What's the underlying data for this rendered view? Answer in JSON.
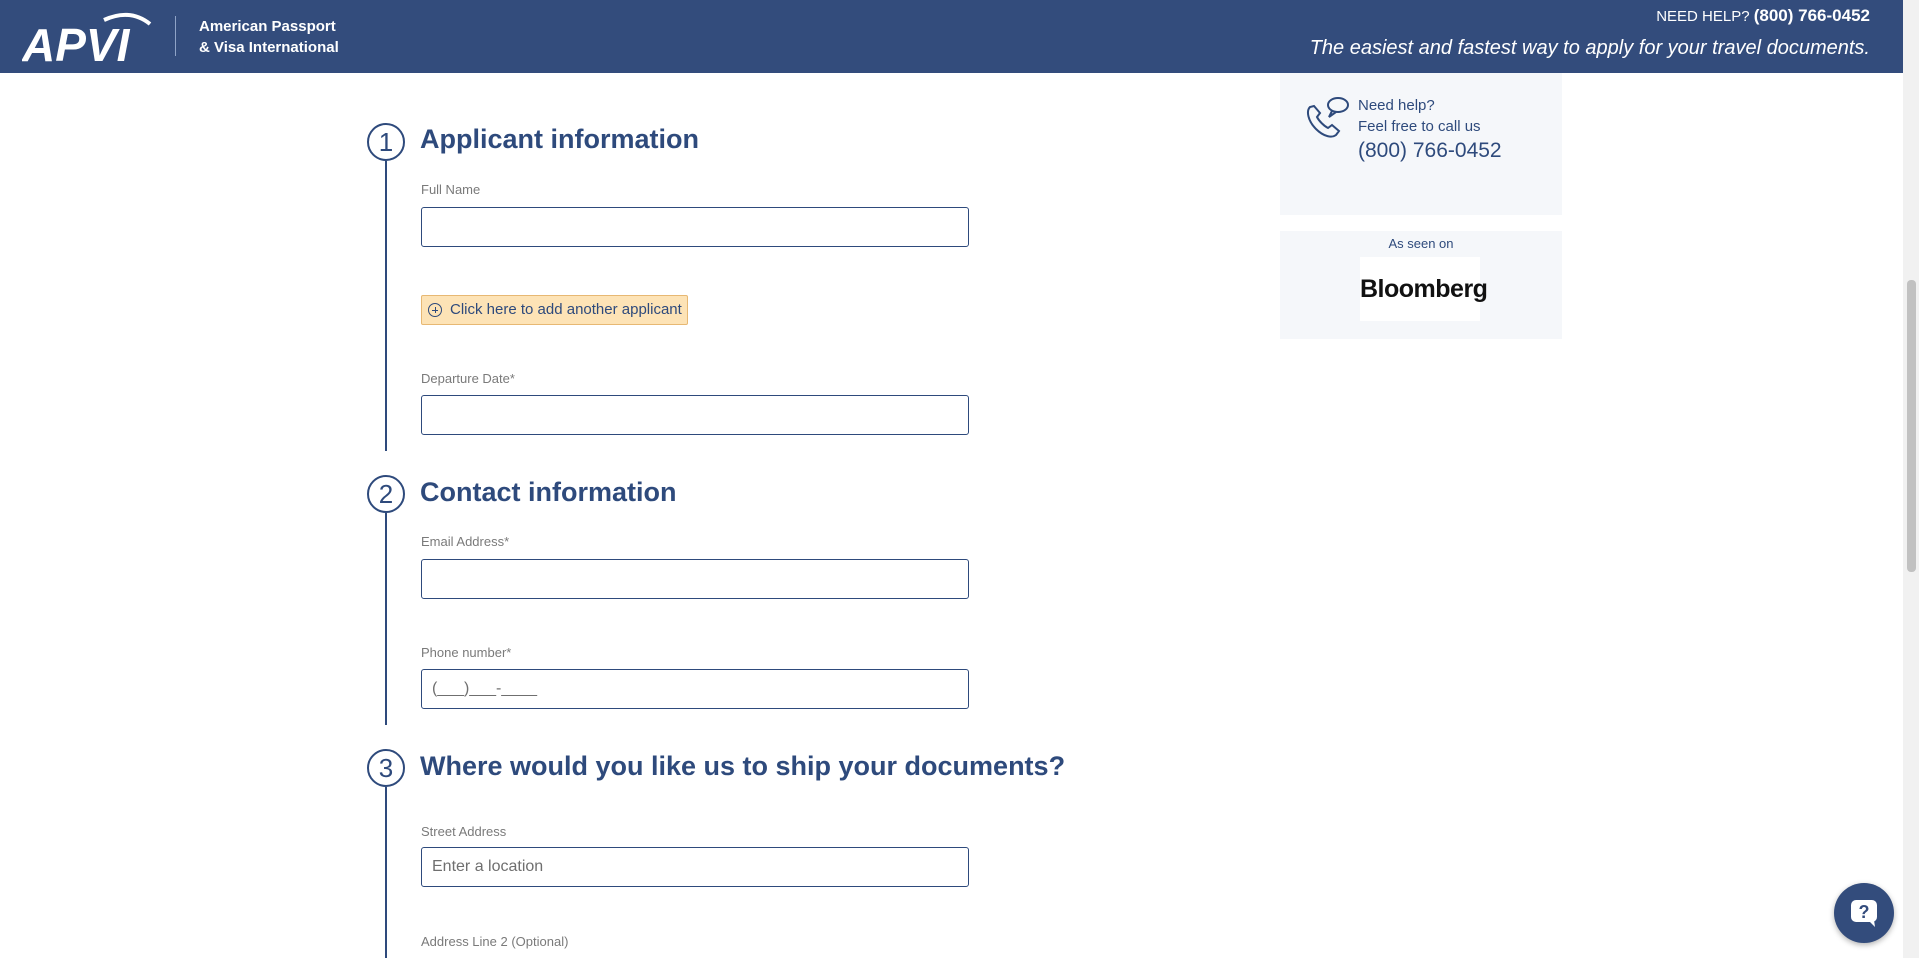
{
  "header": {
    "logo_text": "APVI",
    "company_line1": "American Passport",
    "company_line2": "& Visa International",
    "help_label": "NEED HELP?",
    "help_number": "(800) 766-0452",
    "tagline": "The easiest and fastest way to apply for your travel documents."
  },
  "sections": [
    {
      "number": "1",
      "title": "Applicant information",
      "fields": [
        {
          "label": "Full Name",
          "value": ""
        },
        {
          "label": "Departure Date*",
          "value": ""
        }
      ],
      "add_applicant_label": "Click here to add another applicant"
    },
    {
      "number": "2",
      "title": "Contact information",
      "fields": [
        {
          "label": "Email Address*",
          "value": ""
        },
        {
          "label": "Phone number*",
          "value": "(___)___-____"
        }
      ]
    },
    {
      "number": "3",
      "title": "Where would you like us to ship your documents?",
      "fields": [
        {
          "label": "Street Address",
          "placeholder": "Enter a location"
        },
        {
          "label": "Address Line 2 (Optional)"
        }
      ]
    }
  ],
  "sidebar": {
    "help_line1": "Need help?",
    "help_line2": "Feel free to call us",
    "help_number": "(800) 766-0452",
    "seen_on_label": "As seen on",
    "seen_on_brand": "Bloomberg"
  },
  "colors": {
    "brand_navy": "#334c7c",
    "text_navy": "#2e4a7c",
    "add_applicant_bg": "#fde3b6",
    "sidebar_bg": "#f5f7fa"
  },
  "icons": {
    "logo": "apvi-logo",
    "phone": "phone-chat-icon",
    "add": "plus-circle-icon",
    "chat": "help-chat-icon"
  }
}
